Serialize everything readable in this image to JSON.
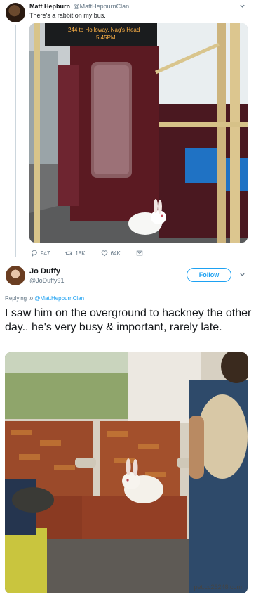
{
  "tweet1": {
    "name": "Matt Hepburn",
    "handle": "@MattHepburnClan",
    "text": "There's a rabbit on my bus.",
    "photo": {
      "bus_sign": "244 to Holloway, Nag's Head",
      "bus_time": "5:45PM"
    },
    "actions": {
      "replies": "947",
      "retweets": "18K",
      "likes": "64K"
    }
  },
  "tweet2": {
    "name": "Jo Duffy",
    "handle": "@JoDuffy91",
    "follow_label": "Follow",
    "replying_prefix": "Replying to",
    "replying_to": "@MattHepburnClan",
    "text": "I saw him on the overground to hackney the other day.. he's very busy & important, rarely late."
  },
  "watermark": "pet.cc26248.com",
  "icons": {
    "reply": "reply-icon",
    "retweet": "retweet-icon",
    "like": "heart-icon",
    "message": "direct-message-icon",
    "caret": "chevron-down-icon"
  },
  "colors": {
    "accent": "#1da1f2",
    "secondary_text": "#657786",
    "thread_line": "#ccd6dd"
  }
}
